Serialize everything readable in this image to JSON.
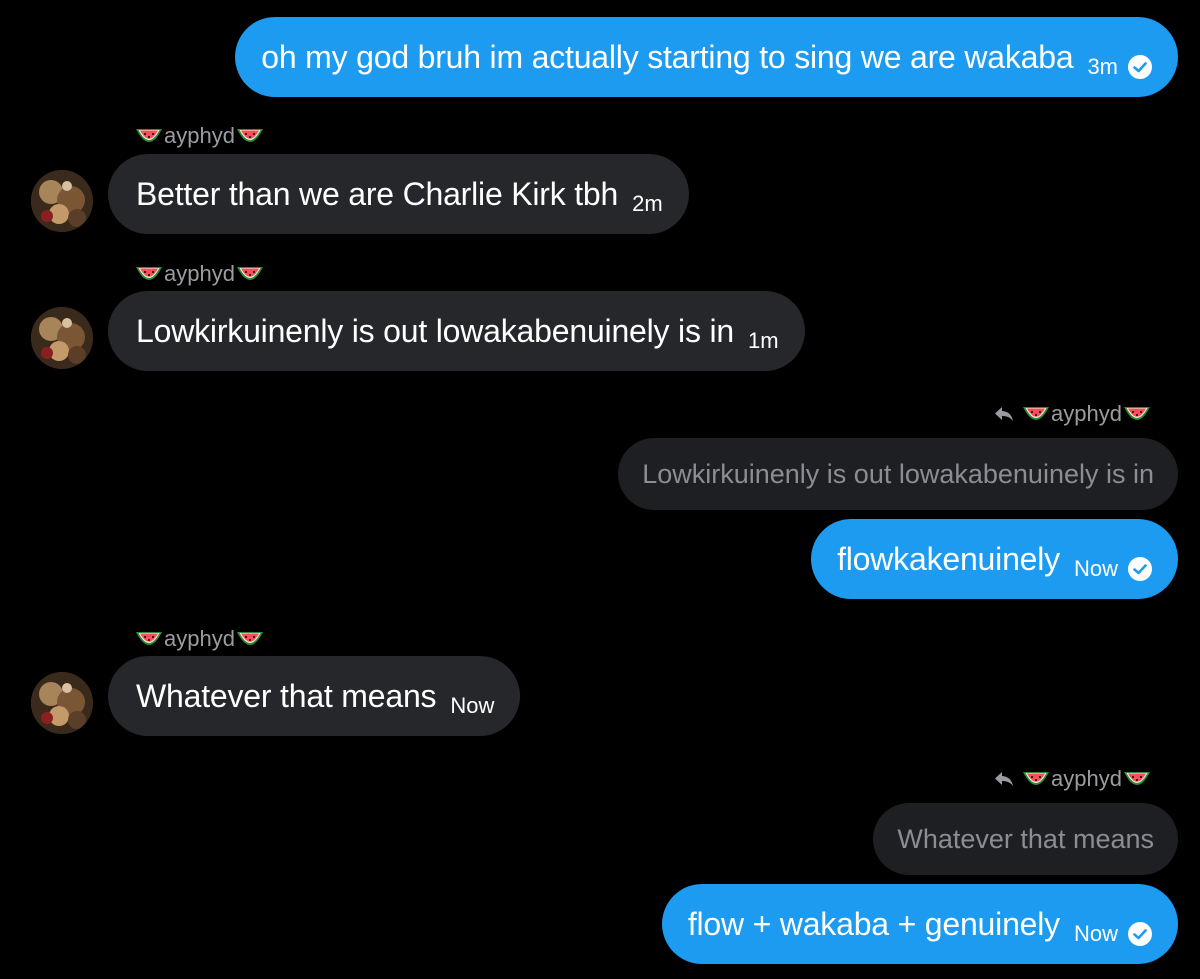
{
  "messages": [
    {
      "id": "m1",
      "direction": "outgoing",
      "text": "oh my god bruh im actually starting to sing we are wakaba",
      "time": "3m",
      "read": true
    },
    {
      "id": "m2",
      "direction": "incoming",
      "sender": "ayphyd",
      "text": "Better than we are Charlie Kirk tbh",
      "time": "2m"
    },
    {
      "id": "m3",
      "direction": "incoming",
      "sender": "ayphyd",
      "text": "Lowkirkuinenly is out lowakabenuinely is in",
      "time": "1m"
    },
    {
      "id": "m4",
      "direction": "outgoing",
      "reply_to_sender": "ayphyd",
      "quoted_text": "Lowkirkuinenly is out lowakabenuinely is in",
      "text": "flowkakenuinely",
      "time": "Now",
      "read": true
    },
    {
      "id": "m5",
      "direction": "incoming",
      "sender": "ayphyd",
      "text": "Whatever that means",
      "time": "Now"
    },
    {
      "id": "m6",
      "direction": "outgoing",
      "reply_to_sender": "ayphyd",
      "quoted_text": "Whatever that means",
      "text": "flow + wakaba + genuinely",
      "time": "Now",
      "read": true
    }
  ],
  "sender_emoji": "watermelon-icon",
  "colors": {
    "background": "#000000",
    "outgoing_bubble": "#1d9bf0",
    "incoming_bubble": "#26272b",
    "quoted_bubble": "#1e1f22",
    "sender_label": "#9a9ca1"
  }
}
